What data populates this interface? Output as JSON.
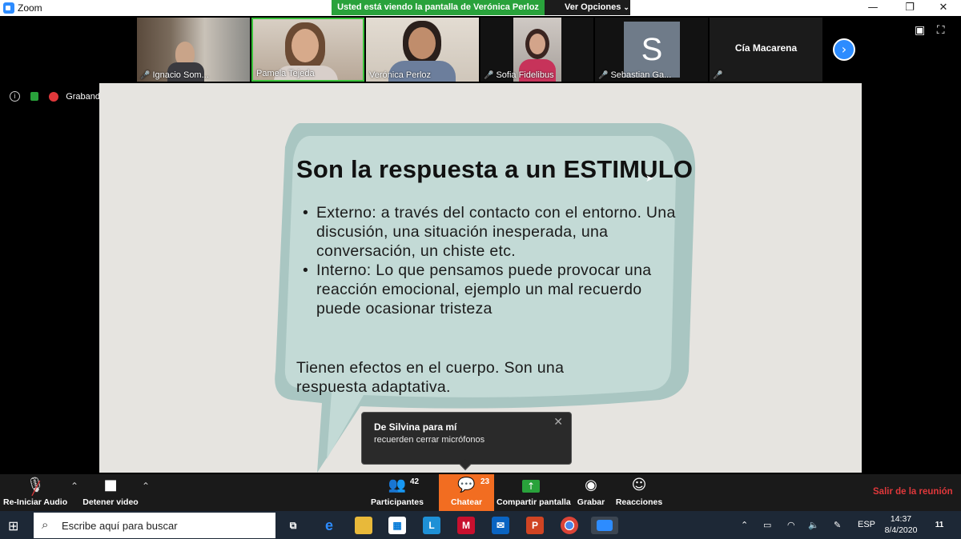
{
  "window": {
    "app_title": "Zoom",
    "minimize": "—",
    "restore": "❐",
    "close": "✕"
  },
  "share_banner": {
    "text": "Usted está viendo la pantalla de Verónica Perloz",
    "view_options": "Ver Opciones"
  },
  "participants_strip": {
    "tiles": [
      {
        "name": "Ignacio Som...",
        "muted": true
      },
      {
        "name": "Pamela Tejeda",
        "muted": false,
        "active_speaker": true
      },
      {
        "name": "Verónica Perloz",
        "muted": false
      },
      {
        "name": "Sofia Fidelibus",
        "muted": true
      },
      {
        "name": "Sebastian Ga...",
        "muted": true,
        "avatar_letter": "S"
      },
      {
        "name": "Cía Macarena",
        "muted": true
      }
    ]
  },
  "status": {
    "recording_label": "Grabando"
  },
  "slide": {
    "title": "Son la respuesta a un ESTIMULO",
    "bullets": [
      "Externo: a través del contacto con el entorno. Una discusión, una situación inesperada, una conversación, un chiste etc.",
      " Interno: Lo que pensamos puede provocar una reacción emocional, ejemplo un mal recuerdo puede ocasionar tristeza"
    ],
    "footer": "Tienen efectos en el cuerpo. Son una respuesta adaptativa."
  },
  "chat_popup": {
    "from": "De Silvina para mí",
    "message": "recuerden cerrar micrófonos"
  },
  "controls": {
    "audio_label": "Re-Iniciar Audio",
    "video_label": "Detener video",
    "participants_label": "Participantes",
    "participants_count": "42",
    "chat_label": "Chatear",
    "chat_count": "23",
    "share_label": "Compartir pantalla",
    "record_label": "Grabar",
    "reactions_label": "Reacciones",
    "leave_label": "Salir de la reunión"
  },
  "taskbar": {
    "search_placeholder": "Escribe aquí para buscar",
    "language": "ESP",
    "time": "14:37",
    "date": "8/4/2020",
    "notifications": "11"
  },
  "colors": {
    "zoom_blue": "#2d8cff",
    "share_green": "#29a23b",
    "chat_orange": "#f26d21",
    "leave_red": "#e0383b",
    "bubble_outer": "#a9c6c2",
    "bubble_inner": "#c3dad6"
  }
}
